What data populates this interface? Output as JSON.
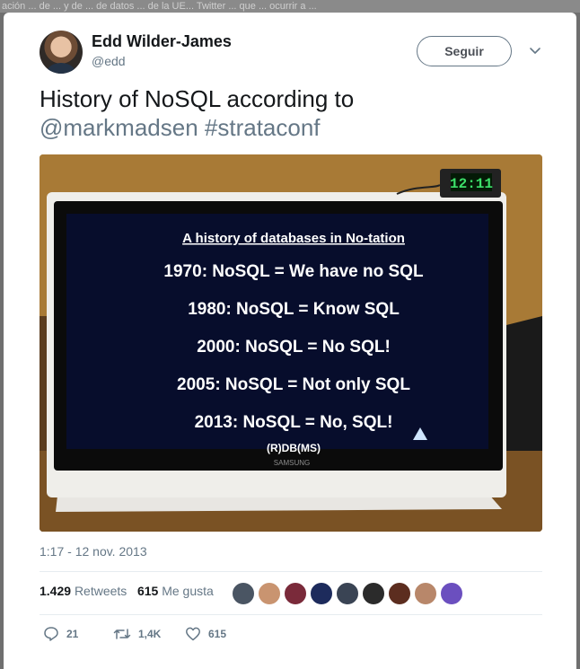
{
  "backdrop": {
    "text": "ación ... de ... y de ... de datos ... de la UE... Twitter ... que ... ocurrir a ..."
  },
  "tweet": {
    "author": {
      "name": "Edd Wilder-James",
      "handle": "@edd"
    },
    "follow_label": "Seguir",
    "text_prefix": "History of NoSQL according to ",
    "mention": "@markmadsen",
    "hashtag": "#strataconf",
    "timestamp": "1:17 - 12 nov. 2013",
    "stats": {
      "retweets_count": "1.429",
      "retweets_label": "Retweets",
      "likes_count": "615",
      "likes_label": "Me gusta"
    },
    "actions": {
      "reply_count": "21",
      "retweet_count": "1,4K",
      "like_count": "615"
    }
  },
  "media": {
    "clock_display": "12:11",
    "slide": {
      "title": "A history of databases in No-tation",
      "lines": [
        "1970: NoSQL = We have no SQL",
        "1980: NoSQL = Know SQL",
        "2000: NoSQL = No SQL!",
        "2005: NoSQL = Not only SQL",
        "2013: NoSQL = No, SQL!"
      ],
      "footer": "(R)DB(MS)"
    },
    "monitor_brand": "SAMSUNG"
  },
  "colors": {
    "link": "#657786",
    "text": "#14171a",
    "divider": "#e6ecf0",
    "slide_bg": "#070d2c"
  },
  "icons": [
    "chevron-down-icon",
    "reply-icon",
    "retweet-icon",
    "heart-icon"
  ],
  "liker_colors": [
    "#4a5563",
    "#c99470",
    "#7a2a3a",
    "#1d2b5c",
    "#3a4454",
    "#2b2b2b",
    "#5c2d1f",
    "#b8876a",
    "#6b4fbf"
  ]
}
